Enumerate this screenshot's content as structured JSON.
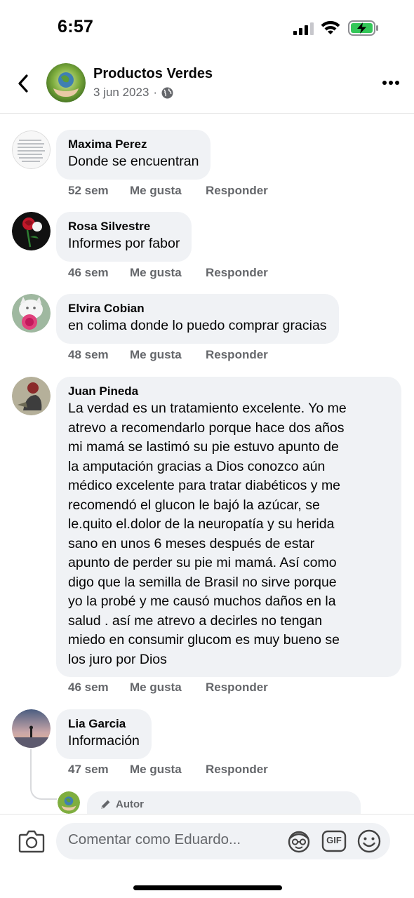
{
  "status_bar": {
    "time": "6:57",
    "icons": [
      "signal-icon",
      "wifi-icon",
      "battery-charging-icon"
    ]
  },
  "header": {
    "back_icon": "chevron-left-icon",
    "page_name": "Productos Verdes",
    "date": "3 jun 2023",
    "separator": "·",
    "privacy_icon": "globe-icon",
    "more_icon": "more-horizontal-icon"
  },
  "comments": [
    {
      "name": "Maxima Perez",
      "text": "Donde se encuentran",
      "time": "52 sem",
      "like": "Me gusta",
      "reply": "Responder"
    },
    {
      "name": "Rosa Silvestre",
      "text": "Informes por fabor",
      "time": "46 sem",
      "like": "Me gusta",
      "reply": "Responder"
    },
    {
      "name": "Elvira Cobian",
      "text": "en colima donde lo puedo comprar gracias",
      "time": "48 sem",
      "like": "Me gusta",
      "reply": "Responder"
    },
    {
      "name": "Juan Pineda",
      "text": "La verdad es un tratamiento excelente.  Yo me\natrevo a recomendarlo porque hace dos años\nmi mamá se lastimó su pie estuvo apunto de\nla amputación gracias a Dios conozco aún\nmédico excelente para tratar diabéticos y me\nrecomendó el glucon  le bajó la azúcar,  se\nle.quito el.dolor de la neuropatía y su herida\nsano en unos 6 meses después de estar\napunto de perder su pie mi mamá.  Así como\ndigo que la semilla de Brasil no sirve porque\nyo la probé y me causó muchos daños en la\nsalud . así me atrevo a decirles no tengan\nmiedo en consumir glucom es muy bueno se\nlos juro por Dios",
      "time": "46 sem",
      "like": "Me gusta",
      "reply": "Responder"
    },
    {
      "name": "Lia Garcia",
      "text": "Información",
      "time": "47 sem",
      "like": "Me gusta",
      "reply": "Responder"
    }
  ],
  "reply_preview": {
    "badge_icon": "pencil-icon",
    "badge": "Autor"
  },
  "composer": {
    "camera_icon": "camera-icon",
    "placeholder": "Comentar como Eduardo...",
    "avatar_icon": "avatar-sticker-icon",
    "gif_label": "GIF",
    "emoji_icon": "smiley-icon"
  },
  "colors": {
    "bubble": "#f0f2f5",
    "secondary_text": "#65676b",
    "battery_fill": "#34c759"
  }
}
